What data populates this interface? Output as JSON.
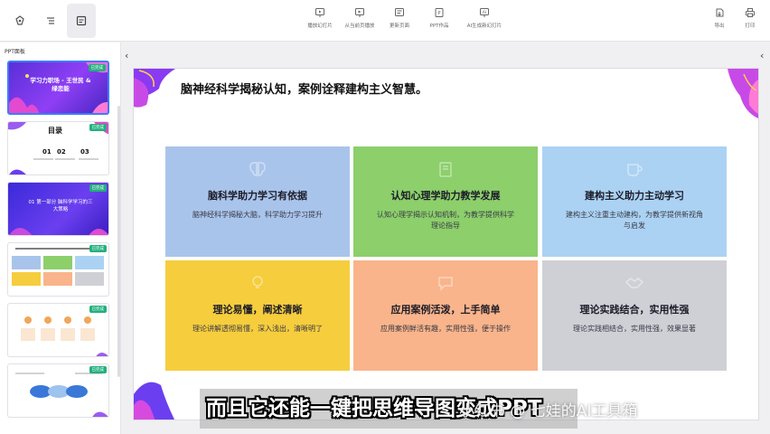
{
  "toolbar": {
    "left_buttons": [
      {
        "name": "home-button",
        "icon": "logo-icon",
        "label": ""
      },
      {
        "name": "outline-button",
        "icon": "outline-icon",
        "label": ""
      },
      {
        "name": "ppt-button",
        "icon": "ppt-icon",
        "label": ""
      }
    ],
    "center_items": [
      {
        "label": "播放幻灯片",
        "icon": "play-icon"
      },
      {
        "label": "从当前页播放",
        "icon": "play-current-icon"
      },
      {
        "label": "更新页面",
        "icon": "refresh-page-icon"
      },
      {
        "label": "PPT作品",
        "icon": "ppt-works-icon"
      },
      {
        "label": "AI生成新幻灯片",
        "icon": "ai-generate-icon"
      }
    ],
    "right_items": [
      {
        "label": "导出",
        "icon": "export-icon"
      },
      {
        "label": "打印",
        "icon": "print-icon"
      }
    ]
  },
  "panel": {
    "title": "PPT面板",
    "badge_label": "已完成",
    "thumbnails": [
      {
        "text": "学习力职场 - 王世民 & 绿恋能"
      },
      {
        "text": "目录"
      },
      {
        "text": "01 第一部分 脑科学学习的三大策略"
      },
      {
        "text": ""
      },
      {
        "text": ""
      },
      {
        "text": ""
      }
    ]
  },
  "slide": {
    "title": "脑神经科学揭秘认知，案例诠释建构主义智慧。",
    "cards": [
      {
        "title": "脑科学助力学习有依据",
        "body": "脑神经科学揭秘大脑，科学助力学习提升",
        "color": "#a9c4eb",
        "icon": "brain-icon"
      },
      {
        "title": "认知心理学助力教学发展",
        "body": "认知心理学揭示认知机制，为教学提供科学理论指导",
        "color": "#8ccf6b",
        "icon": "book-icon"
      },
      {
        "title": "建构主义助力主动学习",
        "body": "建构主义注重主动建构，为教学提供新视角与启发",
        "color": "#abd2f3",
        "icon": "cup-icon"
      },
      {
        "title": "理论易懂，阐述清晰",
        "body": "理论讲解透彻易懂，深入浅出，清晰明了",
        "color": "#f6cd3d",
        "icon": "bulb-icon"
      },
      {
        "title": "应用案例活泼，上手简单",
        "body": "应用案例鲜活有趣，实用性强，便于操作",
        "color": "#f9b48b",
        "icon": "chat-icon"
      },
      {
        "title": "理论实践结合，实用性强",
        "body": "理论实践相结合，实用性强，效果显著",
        "color": "#cfcfd6",
        "icon": "handshake-icon"
      }
    ]
  },
  "subtitle": "而且它还能一键把思维导图变成PPT",
  "watermark": "小红书 @ 七娃的AI工具箱"
}
